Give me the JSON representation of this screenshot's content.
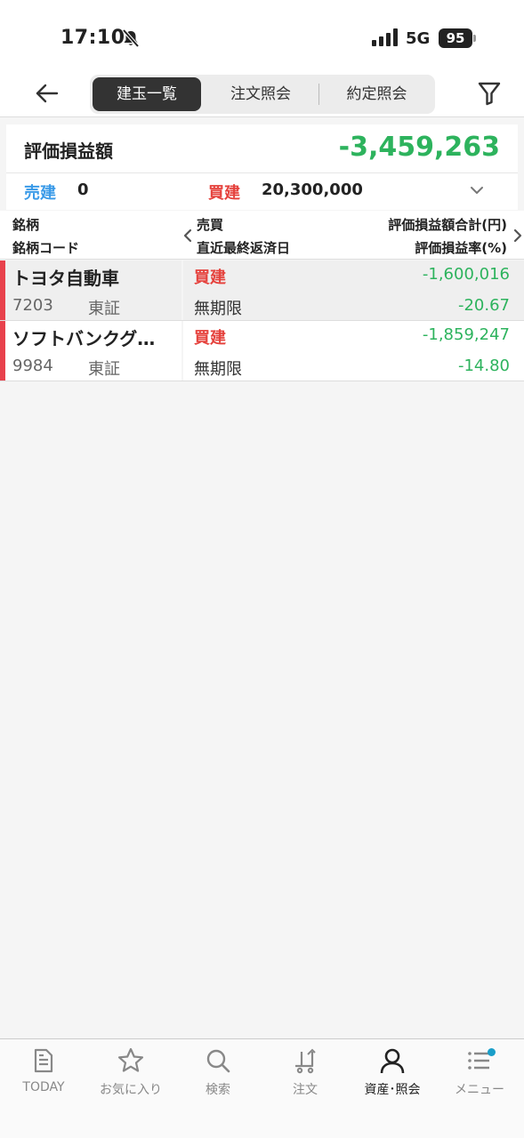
{
  "status_bar": {
    "time": "17:10",
    "network": "5G",
    "battery": "95"
  },
  "header": {
    "tabs": [
      {
        "label": "建玉一覧",
        "active": true
      },
      {
        "label": "注文照会",
        "active": false
      },
      {
        "label": "約定照会",
        "active": false
      }
    ]
  },
  "summary": {
    "label": "評価損益額",
    "value": "-3,459,263",
    "sell_label": "売建",
    "sell_value": "0",
    "buy_label": "買建",
    "buy_value": "20,300,000"
  },
  "table_header": {
    "col1_line1": "銘柄",
    "col1_line2": "銘柄コード",
    "col2_line1": "売買",
    "col2_line2": "直近最終返済日",
    "col3_line1": "評価損益額合計(円)",
    "col3_line2": "評価損益率(%)"
  },
  "rows": [
    {
      "name": "トヨタ自動車",
      "code": "7203",
      "market": "東証",
      "side": "買建",
      "term": "無期限",
      "pl": "-1,600,016",
      "pl_rate": "-20.67"
    },
    {
      "name": "ソフトバンクグ…",
      "code": "9984",
      "market": "東証",
      "side": "買建",
      "term": "無期限",
      "pl": "-1,859,247",
      "pl_rate": "-14.80"
    }
  ],
  "bottom_nav": [
    {
      "label": "TODAY",
      "icon": "document-icon"
    },
    {
      "label": "お気に入り",
      "icon": "star-icon"
    },
    {
      "label": "検索",
      "icon": "search-icon"
    },
    {
      "label": "注文",
      "icon": "cart-icon"
    },
    {
      "label": "資産･照会",
      "icon": "person-icon",
      "active": true
    },
    {
      "label": "メニュー",
      "icon": "menu-icon"
    }
  ],
  "colors": {
    "positive_green": "#2db35d",
    "sell_blue": "#3a9ae8",
    "buy_red": "#e5413c",
    "accent_teal": "#1a9ec9"
  }
}
